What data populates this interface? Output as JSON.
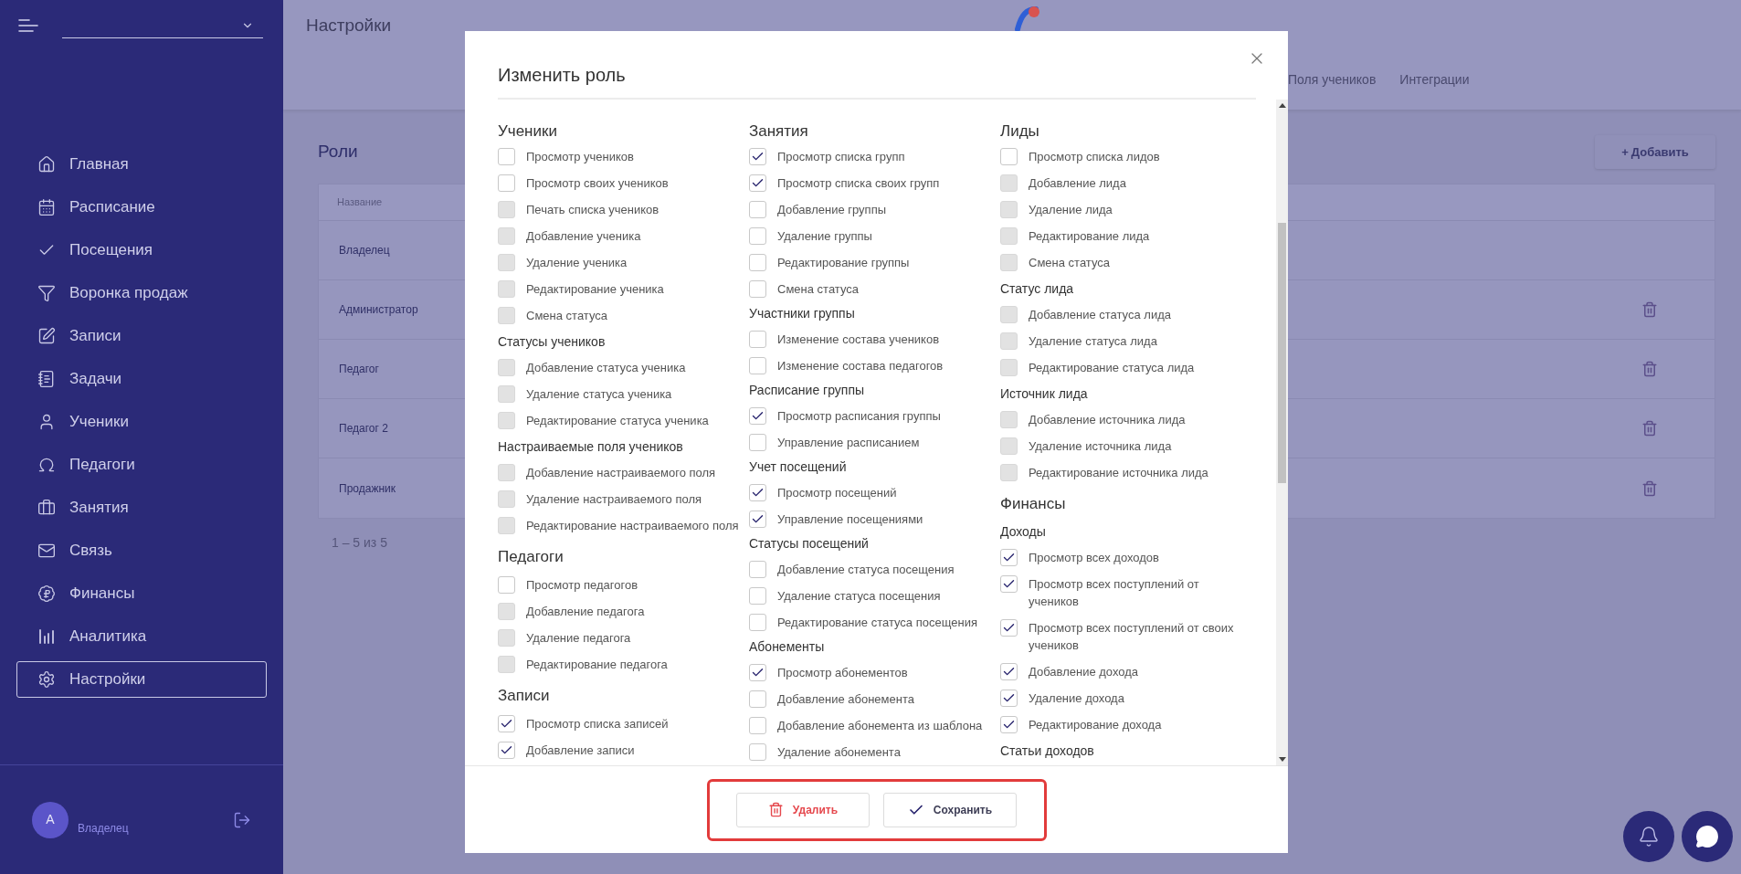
{
  "sidebar": {
    "nav": [
      {
        "label": "Главная",
        "selected": false
      },
      {
        "label": "Расписание",
        "selected": false
      },
      {
        "label": "Посещения",
        "selected": false
      },
      {
        "label": "Воронка продаж",
        "selected": false
      },
      {
        "label": "Записи",
        "selected": false
      },
      {
        "label": "Задачи",
        "selected": false
      },
      {
        "label": "Ученики",
        "selected": false
      },
      {
        "label": "Педагоги",
        "selected": false
      },
      {
        "label": "Занятия",
        "selected": false
      },
      {
        "label": "Связь",
        "selected": false
      },
      {
        "label": "Финансы",
        "selected": false
      },
      {
        "label": "Аналитика",
        "selected": false
      },
      {
        "label": "Настройки",
        "selected": true
      }
    ],
    "user": {
      "avatar": "А",
      "role": "Владелец"
    }
  },
  "header": {
    "title": "Настройки",
    "tabs": [
      {
        "label": "Поля учеников",
        "selected": false
      },
      {
        "label": "Интеграции",
        "selected": false
      }
    ]
  },
  "roles": {
    "title": "Роли",
    "add_button": {
      "icon": "+",
      "label": "Добавить"
    },
    "columns": [
      "Название"
    ],
    "rows": [
      {
        "name": "Владелец",
        "deletable": false
      },
      {
        "name": "Администратор",
        "deletable": true
      },
      {
        "name": "Педагог",
        "deletable": true
      },
      {
        "name": "Педагог 2",
        "deletable": true
      },
      {
        "name": "Продажник",
        "deletable": true
      }
    ],
    "pagination": "1 – 5 из 5"
  },
  "modal": {
    "title": "Изменить роль",
    "columns": [
      [
        {
          "kind": "heading",
          "title": "Ученики"
        },
        {
          "kind": "checkbox",
          "label": "Просмотр учеников",
          "checked": false,
          "disabled": false
        },
        {
          "kind": "checkbox",
          "label": "Просмотр своих учеников",
          "checked": false,
          "disabled": false
        },
        {
          "kind": "checkbox",
          "label": "Печать списка учеников",
          "checked": false,
          "disabled": true
        },
        {
          "kind": "checkbox",
          "label": "Добавление ученика",
          "checked": false,
          "disabled": true
        },
        {
          "kind": "checkbox",
          "label": "Удаление ученика",
          "checked": false,
          "disabled": true
        },
        {
          "kind": "checkbox",
          "label": "Редактирование ученика",
          "checked": false,
          "disabled": true
        },
        {
          "kind": "checkbox",
          "label": "Смена статуса",
          "checked": false,
          "disabled": true
        },
        {
          "kind": "subheading",
          "title": "Статусы учеников"
        },
        {
          "kind": "checkbox",
          "label": "Добавление статуса ученика",
          "checked": false,
          "disabled": true
        },
        {
          "kind": "checkbox",
          "label": "Удаление статуса ученика",
          "checked": false,
          "disabled": true
        },
        {
          "kind": "checkbox",
          "label": "Редактирование статуса ученика",
          "checked": false,
          "disabled": true
        },
        {
          "kind": "subheading",
          "title": "Настраиваемые поля учеников"
        },
        {
          "kind": "checkbox",
          "label": "Добавление настраиваемого поля",
          "checked": false,
          "disabled": true
        },
        {
          "kind": "checkbox",
          "label": "Удаление настраиваемого поля",
          "checked": false,
          "disabled": true
        },
        {
          "kind": "checkbox",
          "label": "Редактирование настраиваемого поля",
          "checked": false,
          "disabled": true
        },
        {
          "kind": "heading",
          "title": "Педагоги"
        },
        {
          "kind": "checkbox",
          "label": "Просмотр педагогов",
          "checked": false,
          "disabled": false
        },
        {
          "kind": "checkbox",
          "label": "Добавление педагога",
          "checked": false,
          "disabled": true
        },
        {
          "kind": "checkbox",
          "label": "Удаление педагога",
          "checked": false,
          "disabled": true
        },
        {
          "kind": "checkbox",
          "label": "Редактирование педагога",
          "checked": false,
          "disabled": true
        },
        {
          "kind": "heading",
          "title": "Записи"
        },
        {
          "kind": "checkbox",
          "label": "Просмотр списка записей",
          "checked": true,
          "disabled": false
        },
        {
          "kind": "checkbox",
          "label": "Добавление записи",
          "checked": true,
          "disabled": false
        }
      ],
      [
        {
          "kind": "heading",
          "title": "Занятия"
        },
        {
          "kind": "checkbox",
          "label": "Просмотр списка групп",
          "checked": true,
          "disabled": false
        },
        {
          "kind": "checkbox",
          "label": "Просмотр списка своих групп",
          "checked": true,
          "disabled": false
        },
        {
          "kind": "checkbox",
          "label": "Добавление группы",
          "checked": false,
          "disabled": false
        },
        {
          "kind": "checkbox",
          "label": "Удаление группы",
          "checked": false,
          "disabled": false
        },
        {
          "kind": "checkbox",
          "label": "Редактирование группы",
          "checked": false,
          "disabled": false
        },
        {
          "kind": "checkbox",
          "label": "Смена статуса",
          "checked": false,
          "disabled": false
        },
        {
          "kind": "subheading",
          "title": "Участники группы"
        },
        {
          "kind": "checkbox",
          "label": "Изменение состава учеников",
          "checked": false,
          "disabled": false
        },
        {
          "kind": "checkbox",
          "label": "Изменение состава педагогов",
          "checked": false,
          "disabled": false
        },
        {
          "kind": "subheading",
          "title": "Расписание группы"
        },
        {
          "kind": "checkbox",
          "label": "Просмотр расписания группы",
          "checked": true,
          "disabled": false
        },
        {
          "kind": "checkbox",
          "label": "Управление расписанием",
          "checked": false,
          "disabled": false
        },
        {
          "kind": "subheading",
          "title": "Учет посещений"
        },
        {
          "kind": "checkbox",
          "label": "Просмотр посещений",
          "checked": true,
          "disabled": false
        },
        {
          "kind": "checkbox",
          "label": "Управление посещениями",
          "checked": true,
          "disabled": false
        },
        {
          "kind": "subheading",
          "title": "Статусы посещений"
        },
        {
          "kind": "checkbox",
          "label": "Добавление статуса посещения",
          "checked": false,
          "disabled": false
        },
        {
          "kind": "checkbox",
          "label": "Удаление статуса посещения",
          "checked": false,
          "disabled": false
        },
        {
          "kind": "checkbox",
          "label": "Редактирование статуса посещения",
          "checked": false,
          "disabled": false
        },
        {
          "kind": "subheading",
          "title": "Абонементы"
        },
        {
          "kind": "checkbox",
          "label": "Просмотр абонементов",
          "checked": true,
          "disabled": false
        },
        {
          "kind": "checkbox",
          "label": "Добавление абонемента",
          "checked": false,
          "disabled": false
        },
        {
          "kind": "checkbox",
          "label": "Добавление абонемента из шаблона",
          "checked": false,
          "disabled": false
        },
        {
          "kind": "checkbox",
          "label": "Удаление абонемента",
          "checked": false,
          "disabled": false
        }
      ],
      [
        {
          "kind": "heading",
          "title": "Лиды"
        },
        {
          "kind": "checkbox",
          "label": "Просмотр списка лидов",
          "checked": false,
          "disabled": false
        },
        {
          "kind": "checkbox",
          "label": "Добавление лида",
          "checked": false,
          "disabled": true
        },
        {
          "kind": "checkbox",
          "label": "Удаление лида",
          "checked": false,
          "disabled": true
        },
        {
          "kind": "checkbox",
          "label": "Редактирование лида",
          "checked": false,
          "disabled": true
        },
        {
          "kind": "checkbox",
          "label": "Смена статуса",
          "checked": false,
          "disabled": true
        },
        {
          "kind": "subheading",
          "title": "Статус лида"
        },
        {
          "kind": "checkbox",
          "label": "Добавление статуса лида",
          "checked": false,
          "disabled": true
        },
        {
          "kind": "checkbox",
          "label": "Удаление статуса лида",
          "checked": false,
          "disabled": true
        },
        {
          "kind": "checkbox",
          "label": "Редактирование статуса лида",
          "checked": false,
          "disabled": true
        },
        {
          "kind": "subheading",
          "title": "Источник лида"
        },
        {
          "kind": "checkbox",
          "label": "Добавление источника лида",
          "checked": false,
          "disabled": true
        },
        {
          "kind": "checkbox",
          "label": "Удаление источника лида",
          "checked": false,
          "disabled": true
        },
        {
          "kind": "checkbox",
          "label": "Редактирование источника лида",
          "checked": false,
          "disabled": true
        },
        {
          "kind": "heading",
          "title": "Финансы"
        },
        {
          "kind": "subheading",
          "title": "Доходы"
        },
        {
          "kind": "checkbox",
          "label": "Просмотр всех доходов",
          "checked": true,
          "disabled": false
        },
        {
          "kind": "checkbox",
          "label": "Просмотр всех поступлений от учеников",
          "checked": true,
          "disabled": false
        },
        {
          "kind": "checkbox",
          "label": "Просмотр всех поступлений от своих учеников",
          "checked": true,
          "disabled": false
        },
        {
          "kind": "checkbox",
          "label": "Добавление дохода",
          "checked": true,
          "disabled": false
        },
        {
          "kind": "checkbox",
          "label": "Удаление дохода",
          "checked": true,
          "disabled": false
        },
        {
          "kind": "checkbox",
          "label": "Редактирование дохода",
          "checked": true,
          "disabled": false
        },
        {
          "kind": "subheading",
          "title": "Статьи доходов"
        }
      ]
    ],
    "buttons": [
      {
        "kind": "delete",
        "label": "Удалить"
      },
      {
        "kind": "save",
        "label": "Сохранить"
      }
    ]
  }
}
